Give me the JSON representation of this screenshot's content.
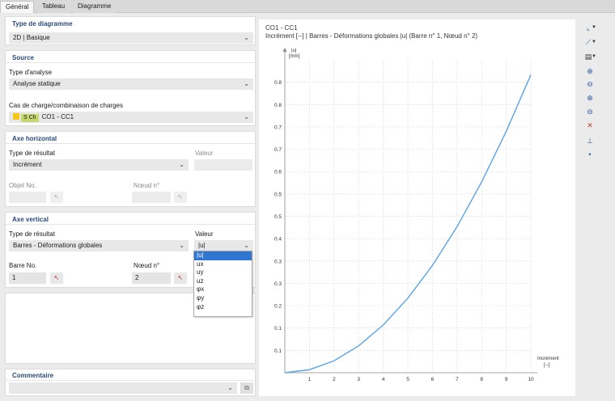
{
  "tabs": [
    {
      "label": "Général",
      "active": true
    },
    {
      "label": "Tableau",
      "active": false
    },
    {
      "label": "Diagramme",
      "active": false
    }
  ],
  "diagram_type": {
    "title": "Type de diagramme",
    "value": "2D | Basique"
  },
  "source": {
    "title": "Source",
    "analysis_label": "Type d'analyse",
    "analysis_value": "Analyse statique",
    "load_label": "Cas de charge/combinaison de charges",
    "load_tag": "S Ch",
    "load_value": "CO1 - CC1",
    "load_tag_color": "#c5d86d",
    "load_swatch_color": "#f5c518"
  },
  "axis_h": {
    "title": "Axe horizontal",
    "result_label": "Type de résultat",
    "result_value": "Incrément",
    "value_label": "Valeur",
    "object_label": "Objet No.",
    "node_label": "Nœud n°"
  },
  "axis_v": {
    "title": "Axe vertical",
    "result_label": "Type de résultat",
    "result_value": "Barres - Déformations globales",
    "value_label": "Valeur",
    "value_value": "|u|",
    "member_label": "Barre No.",
    "member_value": "1",
    "node_label": "Nœud n°",
    "node_value": "2",
    "options": [
      "|u|",
      "ux",
      "uy",
      "uz",
      "φx",
      "φy",
      "φz"
    ],
    "selected_option": 0
  },
  "comment": {
    "title": "Commentaire",
    "value": ""
  },
  "chart_header": {
    "line1": "CO1 - CC1",
    "line2": "Incrément [--] | Barres - Déformations globales |u| (Barre n° 1, Nœud n° 2)"
  },
  "chart_data": {
    "type": "line",
    "ylabel_line1": "|u|",
    "ylabel_line2": "[mm]",
    "xlabel_line1": "Incrément",
    "xlabel_line2": "[--]",
    "x": [
      0,
      1,
      2,
      3,
      4,
      5,
      6,
      7,
      8,
      9,
      10
    ],
    "xticks": [
      "1",
      "2",
      "3",
      "4",
      "5",
      "6",
      "7",
      "8",
      "9",
      "10"
    ],
    "yticks": [
      "0.1",
      "0.1",
      "0.2",
      "0.3",
      "0.3",
      "0.4",
      "0.5",
      "0.5",
      "0.6",
      "0.7",
      "0.7",
      "0.8",
      "0.8"
    ],
    "ytick_values": [
      0.06,
      0.12,
      0.18,
      0.24,
      0.3,
      0.36,
      0.42,
      0.48,
      0.54,
      0.6,
      0.66,
      0.72,
      0.78
    ],
    "series": [
      {
        "values": [
          0,
          0.008,
          0.032,
          0.072,
          0.128,
          0.2,
          0.288,
          0.392,
          0.512,
          0.648,
          0.8
        ],
        "color": "#5aa3e6"
      }
    ],
    "xlim": [
      0,
      10
    ],
    "ylim": [
      0,
      0.84
    ],
    "grid": true
  },
  "toolbar": {
    "icons": [
      "axis-settings-icon",
      "line-style-icon",
      "print-icon",
      "zoom-in-icon",
      "zoom-out-icon",
      "zoom-window-icon",
      "zoom-fit-icon",
      "reset-zoom-icon",
      "axis-origin-icon",
      "point-icon"
    ]
  }
}
